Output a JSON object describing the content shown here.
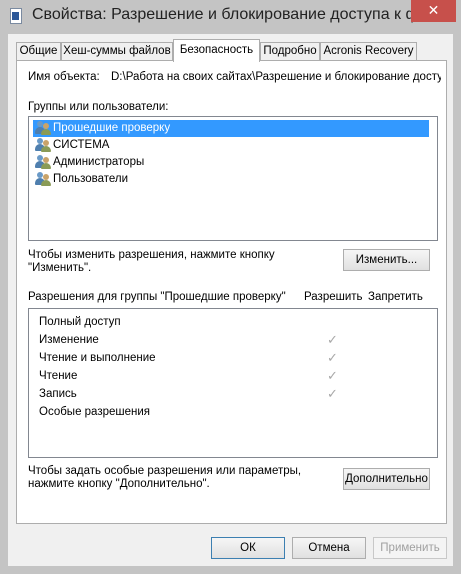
{
  "window": {
    "title": "Свойства: Разрешение и блокирование доступа к фай...",
    "close_glyph": "✕"
  },
  "tabs": [
    {
      "label": "Общие"
    },
    {
      "label": "Хеш-суммы файлов"
    },
    {
      "label": "Безопасность"
    },
    {
      "label": "Подробно"
    },
    {
      "label": "Acronis Recovery"
    }
  ],
  "object": {
    "label": "Имя объекта:",
    "path": "D:\\Работа на своих сайтах\\Разрешение и блокирование доступ"
  },
  "groups": {
    "label": "Группы или пользователи:",
    "items": [
      {
        "name": "Прошедшие проверку",
        "selected": true
      },
      {
        "name": "СИСТЕМА"
      },
      {
        "name": "Администраторы"
      },
      {
        "name": "Пользователи"
      }
    ]
  },
  "edit": {
    "hint": "Чтобы изменить разрешения, нажмите кнопку\n\"Изменить\".",
    "button": "Изменить..."
  },
  "permissions": {
    "header": "Разрешения для группы \"Прошедшие проверку\"",
    "allow_col": "Разрешить",
    "deny_col": "Запретить",
    "check_glyph": "✓",
    "rows": [
      {
        "name": "Полный доступ",
        "allow": false
      },
      {
        "name": "Изменение",
        "allow": true
      },
      {
        "name": "Чтение и выполнение",
        "allow": true
      },
      {
        "name": "Чтение",
        "allow": true
      },
      {
        "name": "Запись",
        "allow": true
      },
      {
        "name": "Особые разрешения",
        "allow": false
      }
    ]
  },
  "advanced": {
    "hint": "Чтобы задать особые разрешения или параметры,\nнажмите кнопку \"Дополнительно\".",
    "button": "Дополнительно"
  },
  "footer": {
    "ok": "ОК",
    "cancel": "Отмена",
    "apply": "Применить"
  }
}
